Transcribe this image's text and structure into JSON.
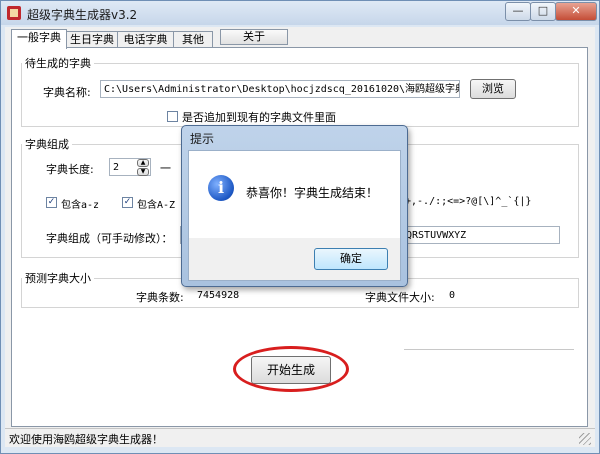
{
  "window": {
    "title": "超级字典生成器v3.2",
    "controls": [
      "—",
      "□",
      "✕"
    ]
  },
  "tabs": [
    "一般字典",
    "生日字典",
    "电话字典",
    "其他",
    "关于"
  ],
  "section_pending": {
    "title": "待生成的字典",
    "name_label": "字典名称:",
    "path_value": "C:\\Users\\Administrator\\Desktop\\hocjzdscq_20161020\\海鸥超级字典生成",
    "browse_label": "浏览",
    "append_label": "是否追加到现有的字典文件里面",
    "append_checked": false
  },
  "section_compose": {
    "title": "字典组成",
    "length_label": "字典长度:",
    "length_value": "2",
    "dash": "一",
    "include_lower_label": "包含a-z",
    "include_lower_checked": true,
    "include_upper_label": "包含A-Z",
    "include_upper_checked": true,
    "symbols_visible": "+,-./:;<=>?@[\\]^_`{|}",
    "manual_label": "字典组成（可手动修改）：",
    "manual_value_visible": "QRSTUVWXYZ"
  },
  "section_predict": {
    "title": "预测字典大小",
    "count_label": "字典条数:",
    "count_value": "7454928",
    "size_label": "字典文件大小:",
    "size_value": "0"
  },
  "start_label": "开始生成",
  "status_text": "欢迎使用海鸥超级字典生成器！",
  "dialog": {
    "title": "提示",
    "icon": "info-icon",
    "message": "恭喜你！字典生成结束！",
    "ok_label": "确定"
  },
  "colors": {
    "title_bar": "#c6d6ea",
    "highlight_ellipse": "#d81e1e",
    "dialog_frame": "#a9c2df"
  }
}
